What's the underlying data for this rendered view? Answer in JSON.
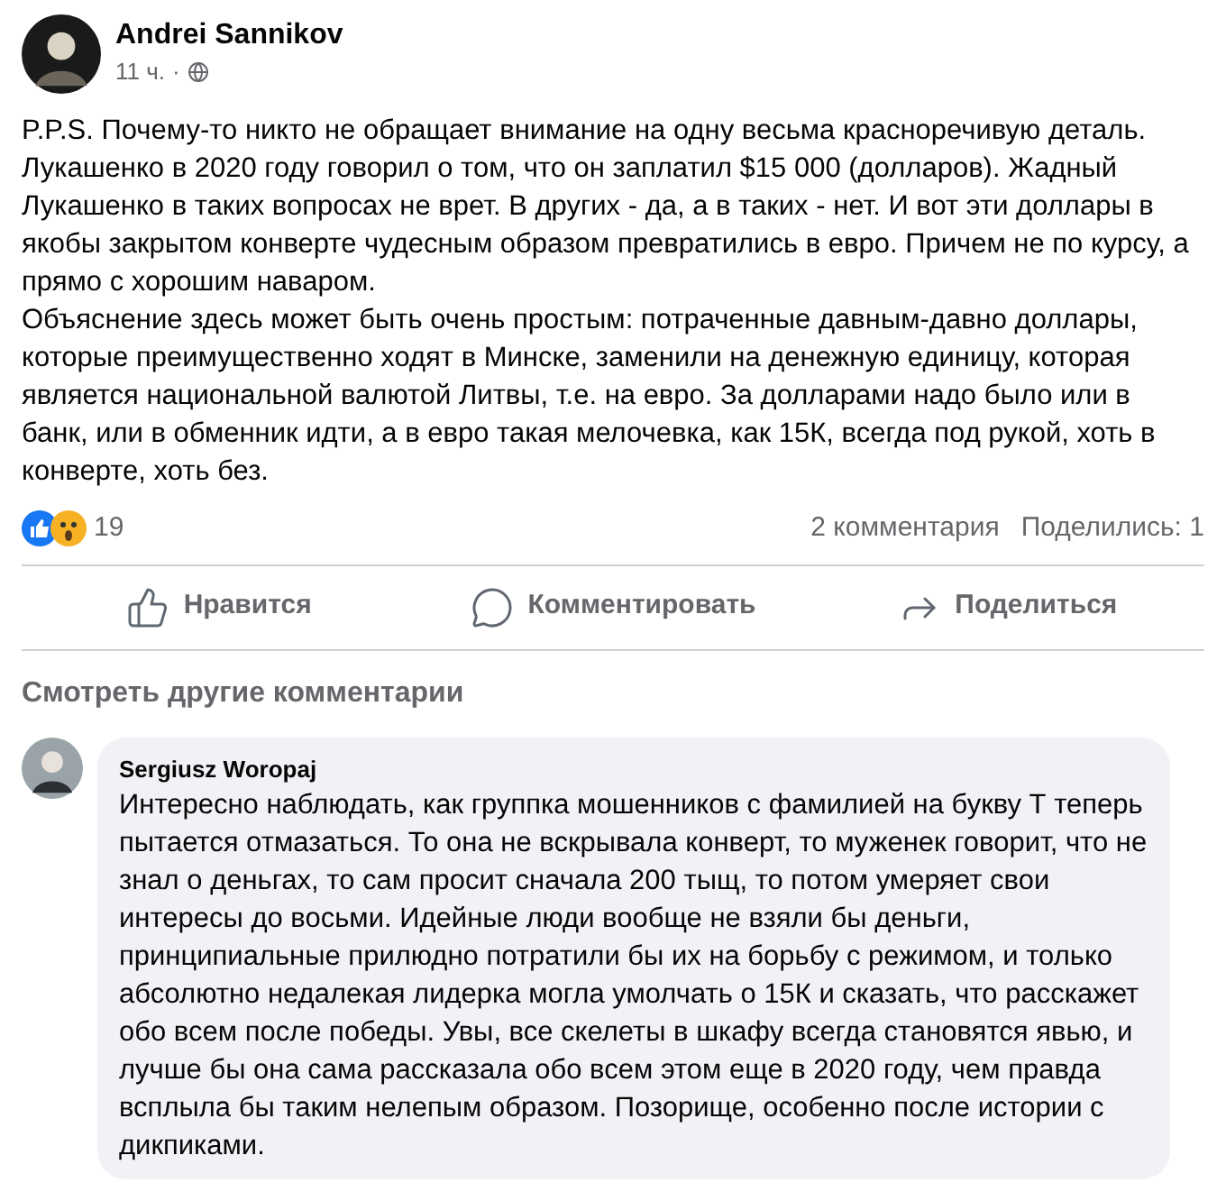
{
  "post": {
    "author": "Andrei Sannikov",
    "time": "11 ч.",
    "separator": "·",
    "paragraphs": [
      "P.P.S. Почему-то никто не обращает внимание на одну весьма красноречивую деталь. Лукашенко в 2020 году говорил о том, что он заплатил $15 000 (долларов). Жадный Лукашенко в таких вопросах не врет. В других - да, а в таких - нет. И вот эти доллары в якобы закрытом конверте  чудесным образом превратились в евро. Причем не по курсу, а прямо с хорошим наваром.",
      "Объяснение здесь может быть очень простым: потраченные давным-давно доллары, которые преимущественно ходят в Минске, заменили на денежную единицу, которая является национальной валютой Литвы, т.е. на евро. За долларами надо было или в банк, или в обменник идти, а в евро такая мелочевка, как 15К, всегда под рукой, хоть в конверте, хоть без."
    ]
  },
  "reactions": {
    "count": "19",
    "comments": "2 комментария",
    "shares": "Поделились: 1"
  },
  "actions": [
    {
      "kind": "like",
      "label": "Нравится"
    },
    {
      "kind": "comment",
      "label": "Комментировать"
    },
    {
      "kind": "share",
      "label": "Поделиться"
    }
  ],
  "more_comments": "Смотреть другие комментарии",
  "comment": {
    "author": "Sergiusz Woropaj",
    "text": "Интересно наблюдать, как группка мошенников с фамилией на букву Т теперь пытается отмазаться. То она не вскрывала конверт, то муженек говорит, что не знал о деньгах, то сам просит сначала 200 тыщ, то потом умеряет свои интересы до восьми. Идейные люди вообще не взяли бы деньги, принципиальные прилюдно потратили бы их на борьбу с режимом, и только абсолютно недалекая лидерка могла умолчать о 15К и сказать, что расскажет обо всем после победы. Увы, все скелеты в шкафу всегда становятся явью, и лучше бы она сама рассказала обо всем этом еще в 2020 году, чем правда всплыла бы таким нелепым образом. Позорище, особенно после истории с дикпиками."
  }
}
